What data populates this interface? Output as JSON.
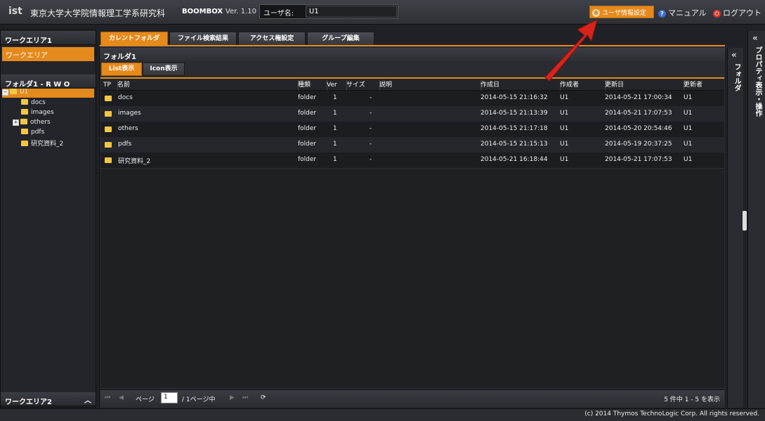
{
  "header": {
    "org": "東京大学大学院情報理工学系研究科",
    "logo_text": "ist",
    "product": "BOOMBOX",
    "version": "Ver. 1.10",
    "user_label": "ユーザ名:",
    "user_value": "U1",
    "user_settings": "ユーザ情報設定",
    "manual": "マニュアル",
    "logout": "ログアウト"
  },
  "left": {
    "workarea1": "ワークエリア1",
    "workarea1_item": "ワークエリア",
    "folder_header": "フォルダ1 - R W O",
    "tree": [
      {
        "label": "U1"
      },
      {
        "label": "docs"
      },
      {
        "label": "images"
      },
      {
        "label": "others"
      },
      {
        "label": "pdfs"
      },
      {
        "label": "研究資料_2"
      }
    ],
    "workarea2": "ワークエリア2"
  },
  "tabs": [
    "カレントフォルダ",
    "ファイル検索結果",
    "アクセス権設定",
    "グループ編集"
  ],
  "folder_title": "フォルダ1",
  "view_tabs": [
    "List表示",
    "Icon表示"
  ],
  "columns": [
    "TP",
    "名前",
    "種類",
    "Ver",
    "サイズ",
    "説明",
    "作成日",
    "作成者",
    "更新日",
    "更新者"
  ],
  "rows": [
    {
      "name": "docs",
      "type": "folder",
      "ver": "1",
      "size": "-",
      "created": "2014-05-15 21:16:32",
      "creator": "U1",
      "updated": "2014-05-21 17:00:34",
      "updater": "U1"
    },
    {
      "name": "images",
      "type": "folder",
      "ver": "1",
      "size": "-",
      "created": "2014-05-15 21:13:39",
      "creator": "U1",
      "updated": "2014-05-21 17:07:53",
      "updater": "U1"
    },
    {
      "name": "others",
      "type": "folder",
      "ver": "1",
      "size": "-",
      "created": "2014-05-15 21:17:18",
      "creator": "U1",
      "updated": "2014-05-20 20:54:46",
      "updater": "U1"
    },
    {
      "name": "pdfs",
      "type": "folder",
      "ver": "1",
      "size": "-",
      "created": "2014-05-15 21:15:13",
      "creator": "U1",
      "updated": "2014-05-19 20:37:25",
      "updater": "U1"
    },
    {
      "name": "研究資料_2",
      "type": "folder",
      "ver": "1",
      "size": "-",
      "created": "2014-05-21 16:18:44",
      "creator": "U1",
      "updated": "2014-05-21 17:07:53",
      "updater": "U1"
    }
  ],
  "pager": {
    "page_label": "ページ",
    "page_value": "1",
    "page_total": "/ 1ページ中",
    "summary": "5 件中 1 - 5 を表示"
  },
  "right": {
    "folder_panel": "フォルダ",
    "property_panel": "プロパティ表示・操作"
  },
  "footer": "(c) 2014 Thymos TechnoLogic Corp. All rights reserved."
}
